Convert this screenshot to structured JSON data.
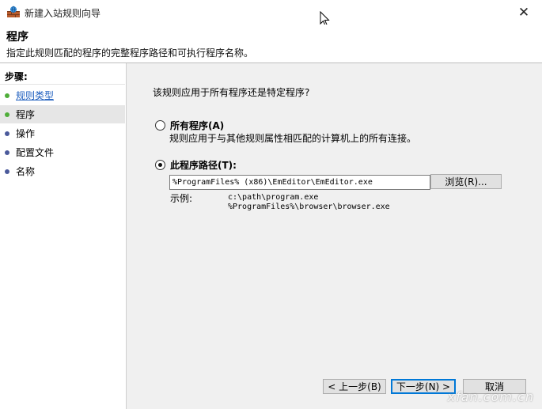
{
  "window": {
    "title": "新建入站规则向导",
    "close_glyph": "✕"
  },
  "header": {
    "title": "程序",
    "description": "指定此规则匹配的程序的完整程序路径和可执行程序名称。"
  },
  "sidebar": {
    "steps_label": "步骤:",
    "items": [
      {
        "label": "规则类型",
        "state": "done"
      },
      {
        "label": "程序",
        "state": "active"
      },
      {
        "label": "操作",
        "state": "pending"
      },
      {
        "label": "配置文件",
        "state": "pending"
      },
      {
        "label": "名称",
        "state": "pending"
      }
    ]
  },
  "main": {
    "question": "该规则应用于所有程序还是特定程序?",
    "all_programs": {
      "label": "所有程序(A)",
      "description": "规则应用于与其他规则属性相匹配的计算机上的所有连接。",
      "checked": false
    },
    "program_path": {
      "label": "此程序路径(T):",
      "checked": true,
      "value": "%ProgramFiles% (x86)\\EmEditor\\EmEditor.exe",
      "browse_label": "浏览(R)..."
    },
    "example": {
      "label": "示例:",
      "lines": [
        "c:\\path\\program.exe",
        "%ProgramFiles%\\browser\\browser.exe"
      ]
    }
  },
  "footer": {
    "back_label": "< 上一步(B)",
    "next_label": "下一步(N) >",
    "cancel_label": "取消"
  },
  "watermark": "xfan.com.cn",
  "colors": {
    "accent": "#0078d7",
    "done_bullet": "#4fae3a",
    "pending_bullet": "#4b5a9b",
    "link": "#1f5fbf"
  }
}
